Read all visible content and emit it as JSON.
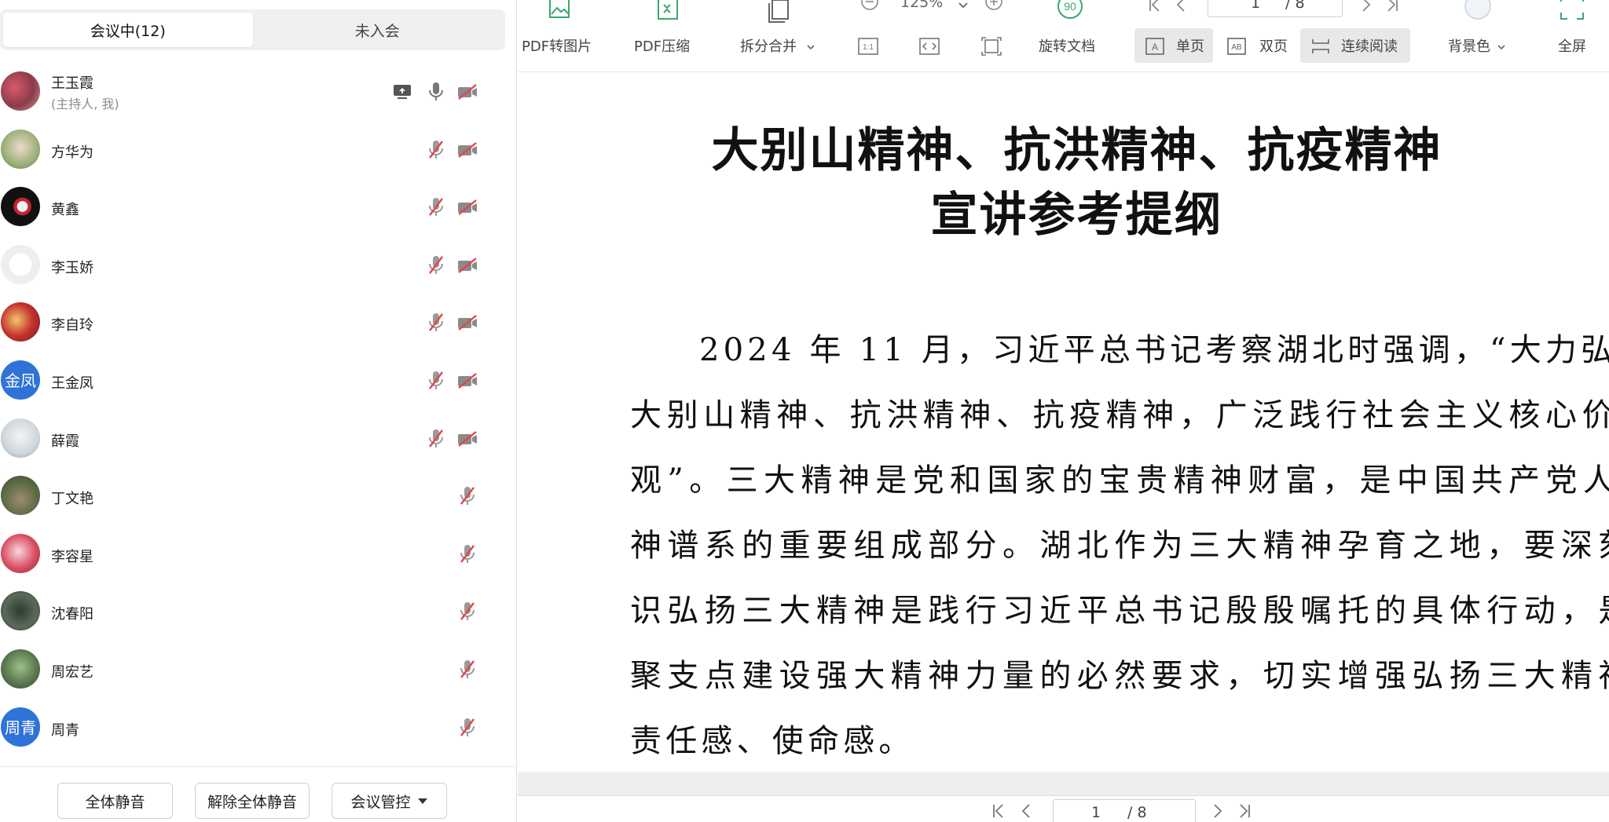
{
  "meeting": {
    "tabs": [
      {
        "label": "会议中(12)",
        "active": true
      },
      {
        "label": "未入会",
        "active": false
      }
    ],
    "participants": [
      {
        "name": "王玉霞",
        "role": "(主持人, 我)",
        "avatar": "photo-flowers",
        "screen_share_icon": true,
        "mic": "on",
        "camera": "off"
      },
      {
        "name": "方华为",
        "avatar": "photo-child",
        "mic": "muted",
        "camera": "off"
      },
      {
        "name": "黄鑫",
        "avatar": "photo-dark",
        "mic": "muted",
        "camera": "off"
      },
      {
        "name": "李玉娇",
        "avatar": "photo-cartoon",
        "mic": "muted",
        "camera": "off"
      },
      {
        "name": "李自玲",
        "avatar": "photo-red",
        "mic": "muted",
        "camera": "off"
      },
      {
        "name": "王金凤",
        "avatar_text": "金凤",
        "mic": "muted",
        "camera": "off"
      },
      {
        "name": "薛霞",
        "avatar": "photo-light",
        "mic": "muted",
        "camera": "off"
      },
      {
        "name": "丁文艳",
        "avatar": "photo-outdoor",
        "mic": "muted"
      },
      {
        "name": "李容星",
        "avatar": "photo-flowers-red",
        "mic": "muted"
      },
      {
        "name": "沈春阳",
        "avatar": "photo-child-2",
        "mic": "muted"
      },
      {
        "name": "周宏艺",
        "avatar": "photo-family",
        "mic": "muted"
      },
      {
        "name": "周青",
        "avatar_text": "周青",
        "mic": "muted"
      }
    ],
    "footer": {
      "mute_all": "全体静音",
      "unmute_all": "解除全体静音",
      "control": "会议管控"
    },
    "colors": {
      "muted_red": "#e0464a",
      "avatar_blue": "#2f73d8"
    }
  },
  "pdf": {
    "toolbar": {
      "to_image": "PDF转图片",
      "compress": "PDF压缩",
      "split_merge": "拆分合并",
      "zoom": "125%",
      "rotate": "旋转文档",
      "single_page": "单页",
      "double_page": "双页",
      "continuous": "连续阅读",
      "background": "背景色",
      "fullscreen": "全屏",
      "page_current": "1",
      "page_total": "/ 8"
    },
    "document": {
      "title_line1": "大别山精神、抗洪精神、抗疫精神",
      "title_line2": "宣讲参考提纲",
      "body_lines": [
        "2024 年 11 月，习近平总书记考察湖北时强调，“大力弘扬",
        "大别山精神、抗洪精神、抗疫精神，广泛践行社会主义核心价值",
        "观”。三大精神是党和国家的宝贵精神财富，是中国共产党人精",
        "神谱系的重要组成部分。湖北作为三大精神孕育之地，要深刻认",
        "识弘扬三大精神是践行习近平总书记殷殷嘱托的具体行动，是凝",
        "聚支点建设强大精神力量的必然要求，切实增强弘扬三大精神的",
        "责任感、使命感。"
      ]
    },
    "pager": {
      "current": "1",
      "total": "/ 8"
    }
  }
}
